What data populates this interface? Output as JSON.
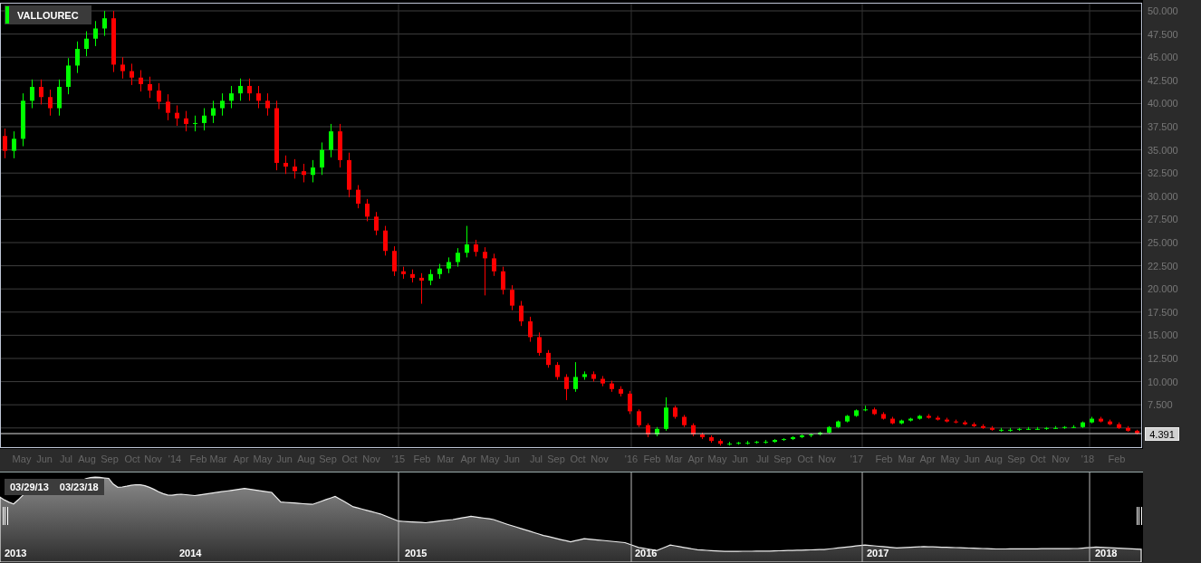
{
  "legend": {
    "symbol": "VALLOUREC"
  },
  "chart": {
    "chart_data": {
      "type": "candlestick",
      "ylim": [
        2.93,
        50.88
      ],
      "grid": true,
      "ref_lines": [
        {
          "axis": "y",
          "value": 4.391,
          "label": "4.391"
        }
      ],
      "yticks": [
        {
          "value": 50,
          "label": "50.000"
        },
        {
          "value": 47.5,
          "label": "47.500"
        },
        {
          "value": 45,
          "label": "45.000"
        },
        {
          "value": 42.5,
          "label": "42.500"
        },
        {
          "value": 40,
          "label": "40.000"
        },
        {
          "value": 37.5,
          "label": "37.500"
        },
        {
          "value": 35,
          "label": "35.000"
        },
        {
          "value": 32.5,
          "label": "32.500"
        },
        {
          "value": 30,
          "label": "30.000"
        },
        {
          "value": 27.5,
          "label": "27.500"
        },
        {
          "value": 25,
          "label": "25.000"
        },
        {
          "value": 22.5,
          "label": "22.500"
        },
        {
          "value": 20,
          "label": "20.000"
        },
        {
          "value": 17.5,
          "label": "17.500"
        },
        {
          "value": 15,
          "label": "15.000"
        },
        {
          "value": 12.5,
          "label": "12.500"
        },
        {
          "value": 10,
          "label": "10.000"
        },
        {
          "value": 7.5,
          "label": "7.500"
        }
      ],
      "categories": [
        null,
        null,
        null,
        null,
        null,
        null,
        null,
        null,
        null,
        null,
        null,
        null,
        null,
        null,
        null,
        null,
        null,
        null,
        null,
        null,
        null,
        null,
        null,
        null,
        null,
        null,
        null,
        null,
        null,
        null,
        null,
        null,
        null,
        null,
        null,
        null,
        null,
        null,
        null,
        null,
        null,
        null,
        null,
        null,
        null,
        null,
        null,
        null,
        null,
        null,
        null,
        null,
        null,
        null,
        null,
        null,
        null,
        null,
        null,
        null,
        null,
        null,
        null,
        null,
        null,
        null,
        null,
        null,
        null,
        null,
        null,
        null,
        null,
        null,
        null,
        null,
        null,
        null,
        null,
        null,
        null,
        null,
        null,
        null,
        null,
        null,
        null,
        null,
        null,
        null,
        null,
        null,
        null,
        null,
        null,
        null,
        null,
        null,
        null,
        null,
        null,
        null,
        null,
        null,
        null,
        null,
        null,
        null,
        null,
        null,
        null,
        null,
        null,
        null,
        null,
        null,
        null,
        null,
        null,
        null,
        null,
        null,
        null,
        null,
        null,
        null
      ],
      "ohlc": [
        [
          36.5,
          37.3,
          34.1,
          34.9
        ],
        [
          34.9,
          37.0,
          34.1,
          36.2
        ],
        [
          36.2,
          41.1,
          35.4,
          40.3
        ],
        [
          40.3,
          42.6,
          39.5,
          41.8
        ],
        [
          41.8,
          42.6,
          39.9,
          40.7
        ],
        [
          40.7,
          41.5,
          38.7,
          39.5
        ],
        [
          39.5,
          42.6,
          38.7,
          41.8
        ],
        [
          41.8,
          44.9,
          41.0,
          44.1
        ],
        [
          44.1,
          46.7,
          43.3,
          45.9
        ],
        [
          45.9,
          47.8,
          45.1,
          47.0
        ],
        [
          47.0,
          48.9,
          46.2,
          48.1
        ],
        [
          48.1,
          50.0,
          47.3,
          49.2
        ],
        [
          49.2,
          50.0,
          43.4,
          44.2
        ],
        [
          44.2,
          45.0,
          42.7,
          43.5
        ],
        [
          43.5,
          44.3,
          42.0,
          42.8
        ],
        [
          42.8,
          43.6,
          41.3,
          42.1
        ],
        [
          42.1,
          42.9,
          40.6,
          41.4
        ],
        [
          41.4,
          42.2,
          39.4,
          40.2
        ],
        [
          40.2,
          41.0,
          38.2,
          39.0
        ],
        [
          39.0,
          39.8,
          37.6,
          38.4
        ],
        [
          38.4,
          39.2,
          37.0,
          37.8
        ],
        [
          37.8,
          38.7,
          37.0,
          37.9
        ],
        [
          37.9,
          39.5,
          37.1,
          38.7
        ],
        [
          38.7,
          40.3,
          37.9,
          39.5
        ],
        [
          39.5,
          41.1,
          38.7,
          40.3
        ],
        [
          40.3,
          41.9,
          39.5,
          41.1
        ],
        [
          41.1,
          42.7,
          40.3,
          41.9
        ],
        [
          41.9,
          42.7,
          40.3,
          41.1
        ],
        [
          41.1,
          41.9,
          39.5,
          40.3
        ],
        [
          40.3,
          41.1,
          38.7,
          39.5
        ],
        [
          39.5,
          40.3,
          32.8,
          33.6
        ],
        [
          33.6,
          34.4,
          32.4,
          33.2
        ],
        [
          33.2,
          34.0,
          31.9,
          32.7
        ],
        [
          32.7,
          33.5,
          31.5,
          32.3
        ],
        [
          32.3,
          33.9,
          31.5,
          33.1
        ],
        [
          33.1,
          35.8,
          32.3,
          35.0
        ],
        [
          35.0,
          37.8,
          34.2,
          37.0
        ],
        [
          37.0,
          37.8,
          33.1,
          33.9
        ],
        [
          33.9,
          34.7,
          29.9,
          30.7
        ],
        [
          30.7,
          31.2,
          28.7,
          29.2
        ],
        [
          29.2,
          29.7,
          27.3,
          27.8
        ],
        [
          27.8,
          28.3,
          25.8,
          26.3
        ],
        [
          26.3,
          26.8,
          23.6,
          24.1
        ],
        [
          24.1,
          24.6,
          21.4,
          21.9
        ],
        [
          21.9,
          22.4,
          21.1,
          21.6
        ],
        [
          21.6,
          22.1,
          20.7,
          21.2
        ],
        [
          21.2,
          21.7,
          18.4,
          20.9
        ],
        [
          20.9,
          22.1,
          20.4,
          21.6
        ],
        [
          21.6,
          22.7,
          21.1,
          22.2
        ],
        [
          22.2,
          23.4,
          21.7,
          22.9
        ],
        [
          22.9,
          24.4,
          22.4,
          23.9
        ],
        [
          23.9,
          26.8,
          23.4,
          24.8
        ],
        [
          24.8,
          25.3,
          23.5,
          24.0
        ],
        [
          24.0,
          24.5,
          19.3,
          23.3
        ],
        [
          23.3,
          23.8,
          21.4,
          21.9
        ],
        [
          21.9,
          22.4,
          19.4,
          19.9
        ],
        [
          19.9,
          20.4,
          17.7,
          18.2
        ],
        [
          18.2,
          18.7,
          16.0,
          16.5
        ],
        [
          16.5,
          17.0,
          14.3,
          14.8
        ],
        [
          14.8,
          15.3,
          12.8,
          13.1
        ],
        [
          13.1,
          13.4,
          11.5,
          11.8
        ],
        [
          11.8,
          12.1,
          10.2,
          10.5
        ],
        [
          10.5,
          10.8,
          8.0,
          9.2
        ],
        [
          9.2,
          12.1,
          8.9,
          10.5
        ],
        [
          10.5,
          11.1,
          10.2,
          10.8
        ],
        [
          10.8,
          11.1,
          10.0,
          10.3
        ],
        [
          10.3,
          10.6,
          9.5,
          9.8
        ],
        [
          9.8,
          10.1,
          8.9,
          9.2
        ],
        [
          9.2,
          9.5,
          8.4,
          8.7
        ],
        [
          8.7,
          9.0,
          6.5,
          6.8
        ],
        [
          6.8,
          7.0,
          5.1,
          5.3
        ],
        [
          5.3,
          5.5,
          4.0,
          4.3
        ],
        [
          4.3,
          5.1,
          4.1,
          4.9
        ],
        [
          4.9,
          8.3,
          4.7,
          7.2
        ],
        [
          7.2,
          7.4,
          6.0,
          6.2
        ],
        [
          6.2,
          6.4,
          5.1,
          5.3
        ],
        [
          5.3,
          5.5,
          4.1,
          4.3
        ],
        [
          4.3,
          4.5,
          3.8,
          4.0
        ],
        [
          4.0,
          4.2,
          3.4,
          3.6
        ],
        [
          3.6,
          3.8,
          3.1,
          3.3
        ],
        [
          3.3,
          3.5,
          3.1,
          3.3
        ],
        [
          3.3,
          3.5,
          3.2,
          3.4
        ],
        [
          3.4,
          3.6,
          3.2,
          3.4
        ],
        [
          3.4,
          3.6,
          3.3,
          3.5
        ],
        [
          3.5,
          3.7,
          3.3,
          3.5
        ],
        [
          3.5,
          3.8,
          3.4,
          3.7
        ],
        [
          3.7,
          3.9,
          3.6,
          3.8
        ],
        [
          3.8,
          4.1,
          3.7,
          4.0
        ],
        [
          4.0,
          4.3,
          3.9,
          4.2
        ],
        [
          4.2,
          4.4,
          4.0,
          4.3
        ],
        [
          4.3,
          4.6,
          4.2,
          4.5
        ],
        [
          4.5,
          5.2,
          4.4,
          5.1
        ],
        [
          5.1,
          5.8,
          5.0,
          5.7
        ],
        [
          5.7,
          6.4,
          5.6,
          6.3
        ],
        [
          6.3,
          7.0,
          6.2,
          6.9
        ],
        [
          6.9,
          7.4,
          6.8,
          7.0
        ],
        [
          7.0,
          7.2,
          6.4,
          6.5
        ],
        [
          6.5,
          6.7,
          5.9,
          6.0
        ],
        [
          6.0,
          6.2,
          5.4,
          5.5
        ],
        [
          5.5,
          5.9,
          5.4,
          5.8
        ],
        [
          5.8,
          6.1,
          5.7,
          6.0
        ],
        [
          6.0,
          6.4,
          5.9,
          6.3
        ],
        [
          6.3,
          6.5,
          6.0,
          6.1
        ],
        [
          6.1,
          6.3,
          5.8,
          5.9
        ],
        [
          5.9,
          6.1,
          5.6,
          5.7
        ],
        [
          5.7,
          5.9,
          5.5,
          5.6
        ],
        [
          5.6,
          5.8,
          5.3,
          5.4
        ],
        [
          5.4,
          5.6,
          5.1,
          5.2
        ],
        [
          5.2,
          5.4,
          4.9,
          5.0
        ],
        [
          5.0,
          5.2,
          4.7,
          4.8
        ],
        [
          4.8,
          5.0,
          4.6,
          4.8
        ],
        [
          4.8,
          5.0,
          4.6,
          4.8
        ],
        [
          4.8,
          5.0,
          4.7,
          4.9
        ],
        [
          4.9,
          5.1,
          4.8,
          4.9
        ],
        [
          4.9,
          5.1,
          4.8,
          4.9
        ],
        [
          4.9,
          5.1,
          4.8,
          5.0
        ],
        [
          5.0,
          5.2,
          4.9,
          5.0
        ],
        [
          5.0,
          5.2,
          4.9,
          5.1
        ],
        [
          5.1,
          5.3,
          5.0,
          5.1
        ],
        [
          5.1,
          5.7,
          5.0,
          5.6
        ],
        [
          5.6,
          6.2,
          5.5,
          6.0
        ],
        [
          6.0,
          6.2,
          5.6,
          5.7
        ],
        [
          5.7,
          5.9,
          5.3,
          5.4
        ],
        [
          5.4,
          5.6,
          4.9,
          5.0
        ],
        [
          5.0,
          5.2,
          4.6,
          4.7
        ],
        [
          4.7,
          4.8,
          4.3,
          4.4
        ]
      ]
    }
  },
  "time_axis": {
    "labels": [
      "May",
      "Jun",
      "Jul",
      "Aug",
      "Sep",
      "Oct",
      "Nov",
      "'14",
      "Feb",
      "Mar",
      "Apr",
      "May",
      "Jun",
      "Aug",
      "Sep",
      "Oct",
      "Nov",
      "'15",
      "Feb",
      "Mar",
      "Apr",
      "May",
      "Jun",
      "Jul",
      "Sep",
      "Oct",
      "Nov",
      "'16",
      "Feb",
      "Mar",
      "Apr",
      "May",
      "Jun",
      "Jul",
      "Sep",
      "Oct",
      "Nov",
      "'17",
      "Feb",
      "Mar",
      "Apr",
      "May",
      "Jun",
      "Aug",
      "Sep",
      "Oct",
      "Nov",
      "'18",
      "Feb"
    ]
  },
  "navigator": {
    "range_start": "03/29/13",
    "range_end": "03/23/18",
    "year_labels": [
      "2013",
      "2014",
      "2015",
      "2016",
      "2017",
      "2018"
    ]
  }
}
